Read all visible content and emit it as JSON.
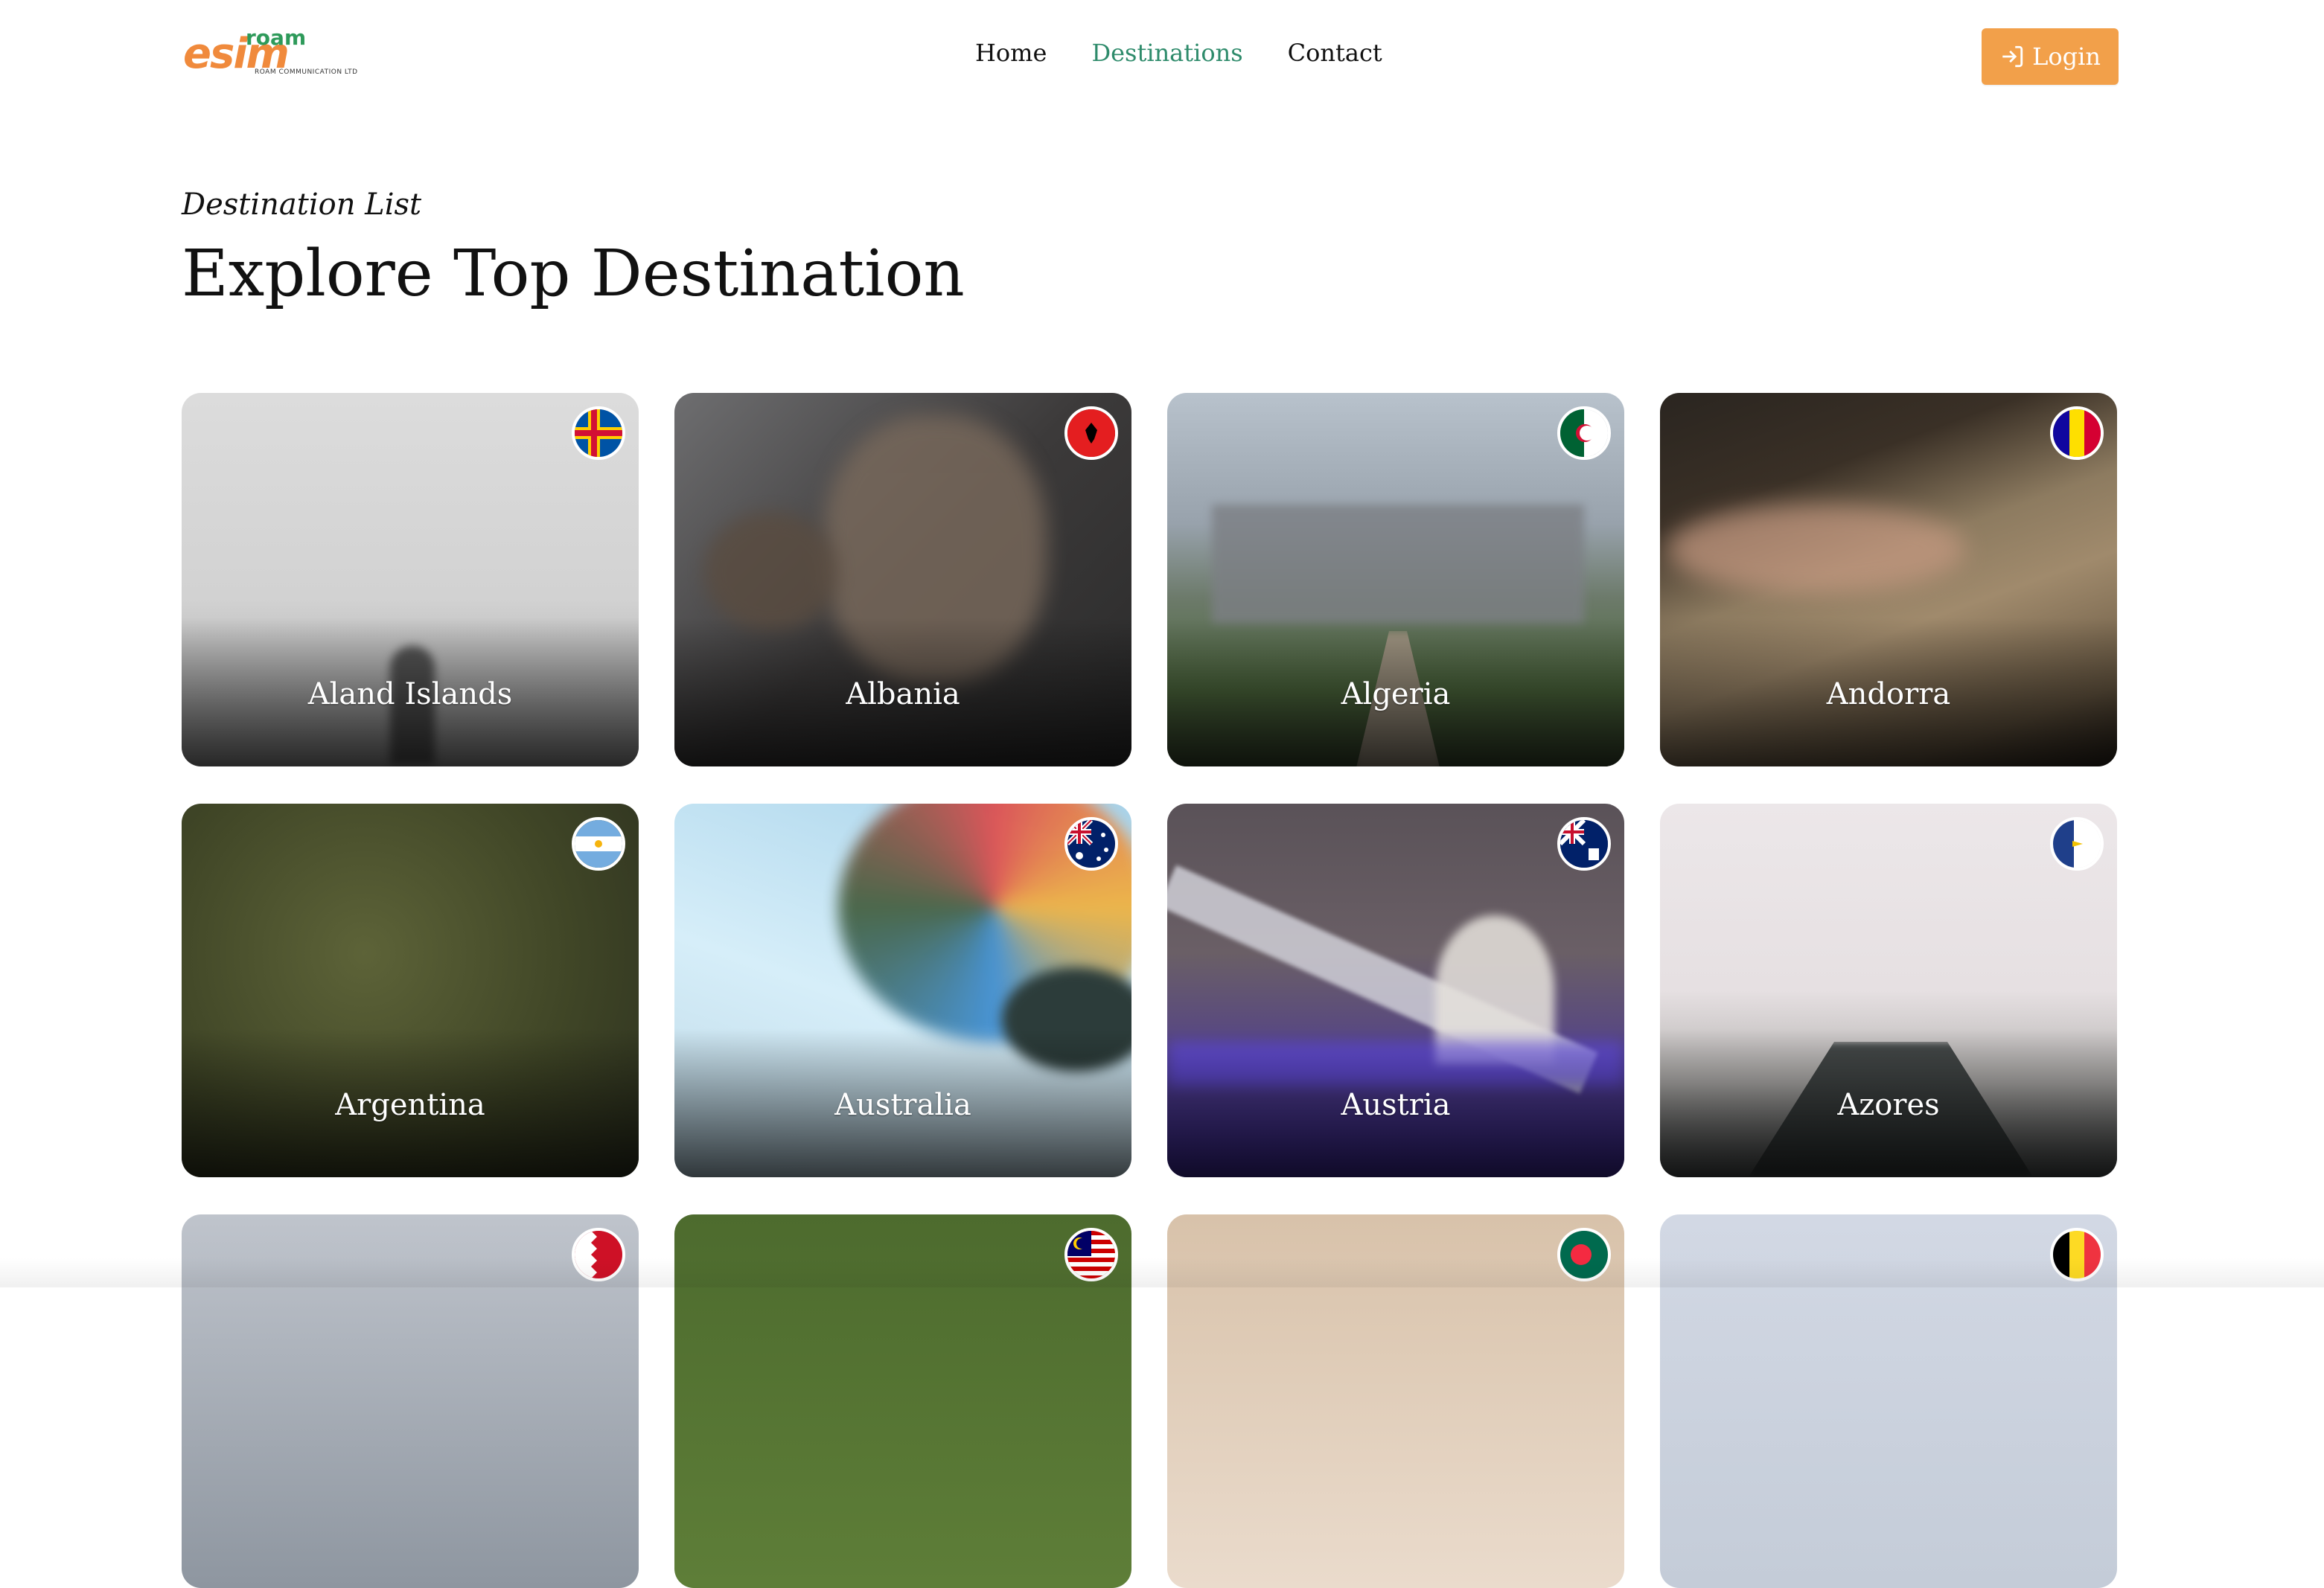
{
  "header": {
    "logo_main": "esim",
    "logo_top": "roam",
    "logo_sub": "ROAM COMMUNICATION LTD",
    "nav": [
      {
        "label": "Home",
        "active": false
      },
      {
        "label": "Destinations",
        "active": true
      },
      {
        "label": "Contact",
        "active": false
      }
    ],
    "login_label": "Login",
    "login_icon": "login-icon"
  },
  "section": {
    "subtitle": "Destination List",
    "title": "Explore Top Destination"
  },
  "colors": {
    "accent_green": "#2e8b6b",
    "login_orange": "#f2a04a",
    "logo_orange": "#f08a3c"
  },
  "destinations": [
    {
      "name": "Aland Islands",
      "flag": "aland-flag-icon"
    },
    {
      "name": "Albania",
      "flag": "albania-flag-icon"
    },
    {
      "name": "Algeria",
      "flag": "algeria-flag-icon"
    },
    {
      "name": "Andorra",
      "flag": "andorra-flag-icon"
    },
    {
      "name": "Argentina",
      "flag": "argentina-flag-icon"
    },
    {
      "name": "Australia",
      "flag": "australia-flag-icon"
    },
    {
      "name": "Austria",
      "flag": "austria-flag-icon"
    },
    {
      "name": "Azores",
      "flag": "azores-flag-icon"
    },
    {
      "name": "",
      "flag": "bahrain-flag-icon"
    },
    {
      "name": "",
      "flag": "malaysia-flag-icon"
    },
    {
      "name": "",
      "flag": "bangladesh-flag-icon"
    },
    {
      "name": "",
      "flag": "belgium-flag-icon"
    }
  ]
}
